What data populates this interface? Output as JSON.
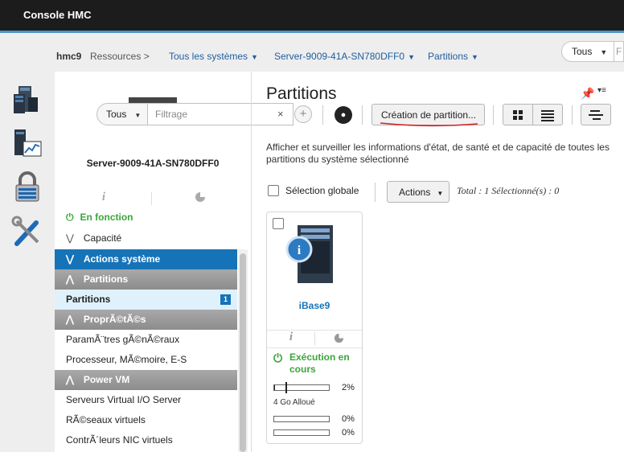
{
  "app": {
    "title": "Console HMC"
  },
  "breadcrumb": {
    "host": "hmc9",
    "resources": "Ressources >",
    "items": [
      "Tous les systèmes",
      "Server-9009-41A-SN780DFF0",
      "Partitions"
    ]
  },
  "top_scope": {
    "label": "Tous",
    "ext": "F"
  },
  "left_rail": {
    "icons": [
      "server-resources-icon",
      "monitoring-icon",
      "security-lock-icon",
      "tools-icon"
    ]
  },
  "system": {
    "name": "Server-9009-41A-SN780DFF0",
    "tab_info": "i"
  },
  "filter": {
    "scope_label": "Tous",
    "placeholder": "Filtrage",
    "clear": "×",
    "add": "+"
  },
  "nav": {
    "status": "En fonction",
    "capacity": "Capacité",
    "actions": "Actions système",
    "section_partitions": "Partitions",
    "partitions_item": "Partitions",
    "partitions_count": "1",
    "section_props": "ProprÃ©tÃ©s",
    "props_items": [
      "ParamÃ¨tres gÃ©nÃ©raux",
      "Processeur, MÃ©moire, E-S"
    ],
    "section_powervm": "Power VM",
    "powervm_items": [
      "Serveurs Virtual I/O Server",
      "RÃ©seaux virtuels",
      "ContrÃ´leurs NIC virtuels"
    ]
  },
  "main": {
    "title": "Partitions",
    "create_button": "Création de partition...",
    "description": "Afficher et surveiller les informations d'état, de santé et de capacité de toutes les partitions du système sélectionné",
    "select_all": "Sélection globale",
    "actions_button": "Actions",
    "total": "Total : 1 Sélectionné(s) : 0"
  },
  "card": {
    "name": "iBase9",
    "info": "i",
    "status": "Exécution en cours",
    "cpu_pct": "2%",
    "cpu_fill": 0.02,
    "memory": "4 Go Alloué",
    "bar2_pct": "0%",
    "bar3_pct": "0%"
  },
  "colors": {
    "accent": "#1773b8",
    "running": "#3aa63a",
    "topbar": "#1c1c1c"
  }
}
